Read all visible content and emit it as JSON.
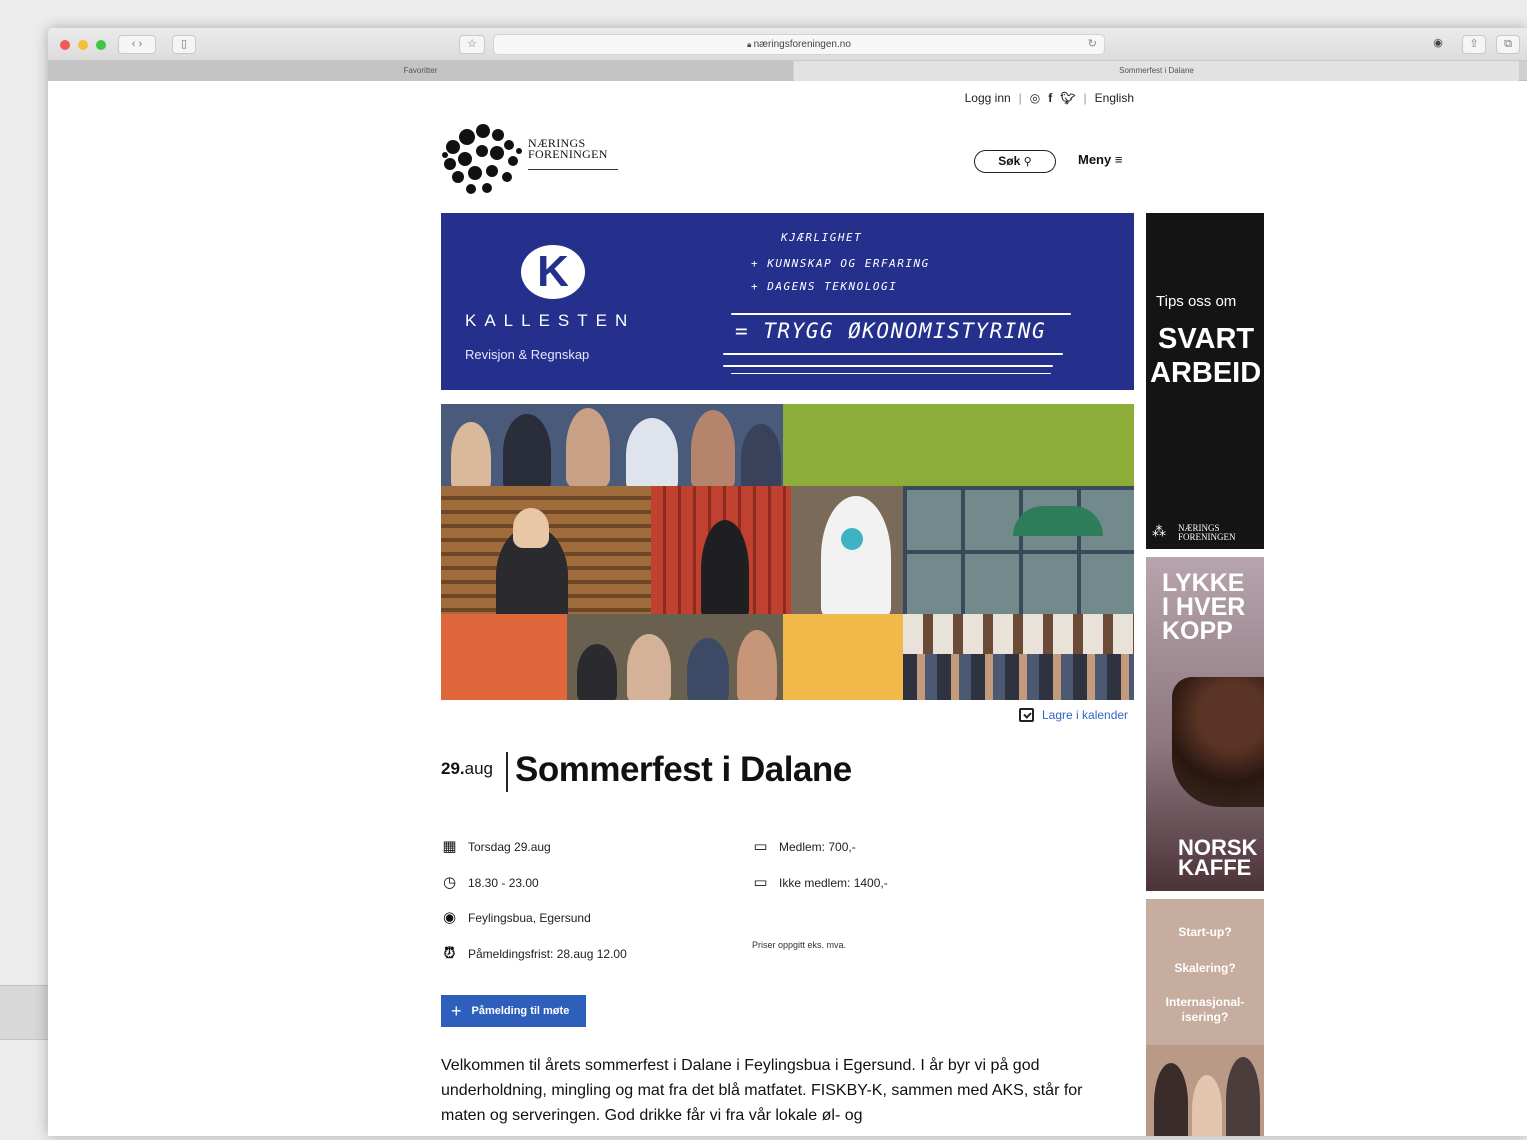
{
  "browser": {
    "address": "næringsforeningen.no",
    "tabs": [
      "Favoritter",
      "Sommerfest i Dalane"
    ]
  },
  "header": {
    "login": "Logg inn",
    "language": "English",
    "search_label": "Søk",
    "menu_label": "Meny",
    "logo_line1": "NÆRINGS",
    "logo_line2": "FORENINGEN"
  },
  "banner": {
    "letter": "K",
    "brand": "KALLESTEN",
    "sub": "Revisjon & Regnskap",
    "line1": "KJÆRLIGHET",
    "line2": "+ KUNNSKAP OG ERFARING",
    "line3": "+ DAGENS TEKNOLOGI",
    "line4": "= TRYGG ØKONOMISTYRING"
  },
  "ads": {
    "ad1_small": "Tips oss om",
    "ad1_big1": "SVART",
    "ad1_big2": "ARBEID",
    "ad1_logo": "NÆRINGS FORENINGEN",
    "ad2_line1": "LYKKE",
    "ad2_line2": "I HVER",
    "ad2_line3": "KOPP",
    "ad2_brand1": "NORSK",
    "ad2_brand2": "KAFFE",
    "ad3_q1": "Start-up?",
    "ad3_q2": "Skalering?",
    "ad3_q3": "Internasjonal-isering?"
  },
  "event": {
    "calendar_link": "Lagre i kalender",
    "day": "29.",
    "month": "aug",
    "title": "Sommerfest i Dalane",
    "date": "Torsdag 29.aug",
    "time": "18.30 - 23.00",
    "place": "Feylingsbua, Egersund",
    "deadline": "Påmeldingsfrist: 28.aug 12.00",
    "price_member": "Medlem: 700,-",
    "price_nonmember": "Ikke medlem: 1400,-",
    "price_note": "Priser oppgitt eks. mva.",
    "signup": "Påmelding til møte",
    "description": "Velkommen til årets sommerfest i Dalane i Feylingsbua i Egersund. I år byr vi på god underholdning, mingling og mat fra det blå matfatet. FISKBY-K, sammen med AKS, står for maten og serveringen. God drikke får vi fra vår lokale øl- og"
  }
}
